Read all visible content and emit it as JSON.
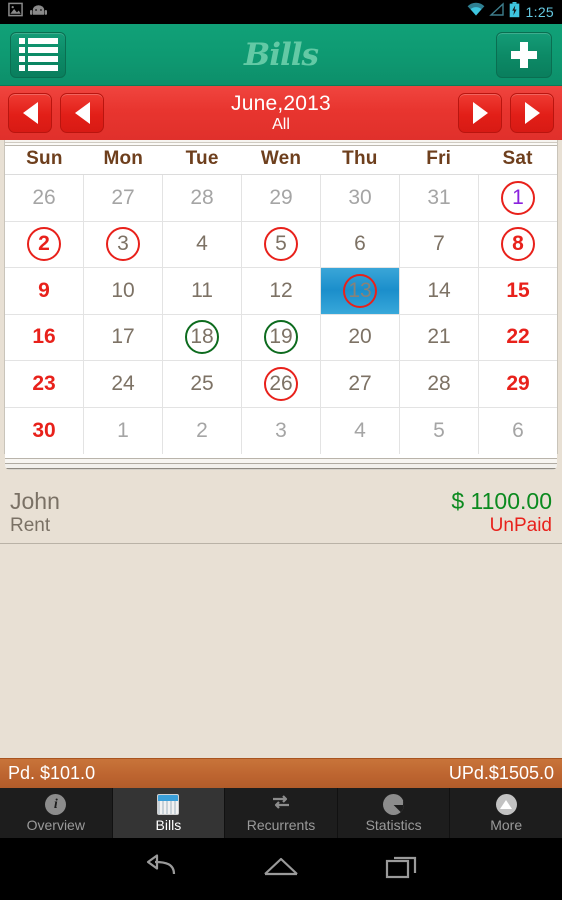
{
  "status_bar": {
    "left_icons": [
      "image-icon",
      "android-robot-icon"
    ],
    "right_icons": [
      "wifi-icon",
      "signal-icon",
      "battery-charging-icon"
    ],
    "clock": "1:25"
  },
  "app_header": {
    "title": "Bills",
    "menu_icon": "list-icon",
    "add_icon": "plus-icon",
    "bg_color": "#0e9a72",
    "logo_color": "#63c9a5"
  },
  "month_nav": {
    "prev_year_icon": "triangle-left-icon",
    "prev_month_icon": "triangle-left-icon",
    "next_month_icon": "triangle-right-icon",
    "next_year_icon": "triangle-right-icon",
    "month_title": "June,2013",
    "filter_label": "All",
    "bg_color": "#e8352f"
  },
  "calendar": {
    "day_headers": [
      "Sun",
      "Mon",
      "Tue",
      "Wen",
      "Thu",
      "Fri",
      "Sat"
    ],
    "header_color": "#6e3f1d",
    "today_bg_color": "#1b8ecb",
    "unpaid_ring_color": "#e8211b",
    "paid_ring_color": "#0d6b1e",
    "weeks": [
      [
        {
          "day": "26",
          "other": true,
          "ring": null
        },
        {
          "day": "27",
          "other": true,
          "ring": null
        },
        {
          "day": "28",
          "other": true,
          "ring": null
        },
        {
          "day": "29",
          "other": true,
          "ring": null
        },
        {
          "day": "30",
          "other": true,
          "ring": null
        },
        {
          "day": "31",
          "other": true,
          "ring": null
        },
        {
          "day": "1",
          "purple": true,
          "ring": "red"
        }
      ],
      [
        {
          "day": "2",
          "weekend": true,
          "ring": "red"
        },
        {
          "day": "3",
          "ring": "red"
        },
        {
          "day": "4",
          "ring": null
        },
        {
          "day": "5",
          "ring": "red"
        },
        {
          "day": "6",
          "ring": null
        },
        {
          "day": "7",
          "ring": null
        },
        {
          "day": "8",
          "weekend": true,
          "ring": "red"
        }
      ],
      [
        {
          "day": "9",
          "weekend": true,
          "ring": null
        },
        {
          "day": "10",
          "ring": null
        },
        {
          "day": "11",
          "ring": null
        },
        {
          "day": "12",
          "ring": null
        },
        {
          "day": "13",
          "today": true,
          "ring": "red"
        },
        {
          "day": "14",
          "ring": null
        },
        {
          "day": "15",
          "weekend": true,
          "ring": null
        }
      ],
      [
        {
          "day": "16",
          "weekend": true,
          "ring": null
        },
        {
          "day": "17",
          "ring": null
        },
        {
          "day": "18",
          "ring": "green"
        },
        {
          "day": "19",
          "ring": "green"
        },
        {
          "day": "20",
          "ring": null
        },
        {
          "day": "21",
          "ring": null
        },
        {
          "day": "22",
          "weekend": true,
          "ring": null
        }
      ],
      [
        {
          "day": "23",
          "weekend": true,
          "ring": null
        },
        {
          "day": "24",
          "ring": null
        },
        {
          "day": "25",
          "ring": null
        },
        {
          "day": "26",
          "ring": "red"
        },
        {
          "day": "27",
          "ring": null
        },
        {
          "day": "28",
          "ring": null
        },
        {
          "day": "29",
          "weekend": true,
          "ring": null
        }
      ],
      [
        {
          "day": "30",
          "weekend": true,
          "ring": null
        },
        {
          "day": "1",
          "other": true,
          "ring": null
        },
        {
          "day": "2",
          "other": true,
          "ring": null
        },
        {
          "day": "3",
          "other": true,
          "ring": null
        },
        {
          "day": "4",
          "other": true,
          "ring": null
        },
        {
          "day": "5",
          "other": true,
          "ring": null
        },
        {
          "day": "6",
          "other": true,
          "ring": null
        }
      ]
    ]
  },
  "bills": [
    {
      "name": "John",
      "category": "Rent",
      "amount": "$ 1100.00",
      "status": "UnPaid",
      "amount_color": "#0b8a1f",
      "status_color": "#e8211b"
    }
  ],
  "totals": {
    "paid_label": "Pd. $101.0",
    "unpaid_label": "UPd.$1505.0",
    "bg_color": "#bd6530"
  },
  "tabs": [
    {
      "label": "Overview",
      "icon": "info-icon",
      "active": false
    },
    {
      "label": "Bills",
      "icon": "calendar-icon",
      "active": true
    },
    {
      "label": "Recurrents",
      "icon": "repeat-icon",
      "active": false
    },
    {
      "label": "Statistics",
      "icon": "pie-chart-icon",
      "active": false
    },
    {
      "label": "More",
      "icon": "triangle-up-icon",
      "active": false
    }
  ],
  "nav_bar": {
    "back_icon": "back-arrow-icon",
    "home_icon": "home-icon",
    "recents_icon": "recents-icon"
  }
}
